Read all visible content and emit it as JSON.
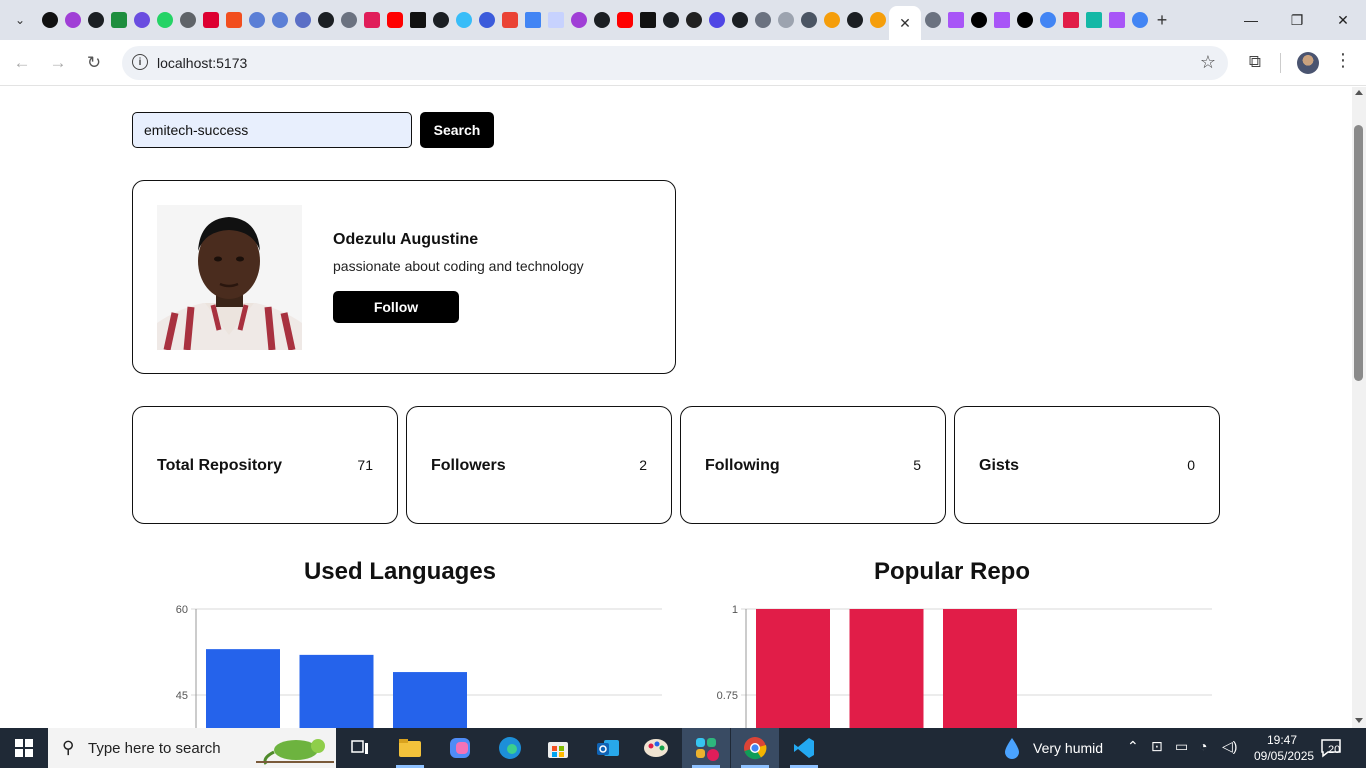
{
  "browser": {
    "url": "localhost:5173",
    "tab_close": "✕"
  },
  "search": {
    "value": "emitech-success",
    "button": "Search"
  },
  "profile": {
    "name": "Odezulu Augustine",
    "bio": "passionate about coding and technology",
    "follow_label": "Follow"
  },
  "stats": [
    {
      "label": "Total Repository",
      "value": "71"
    },
    {
      "label": "Followers",
      "value": "2"
    },
    {
      "label": "Following",
      "value": "5"
    },
    {
      "label": "Gists",
      "value": "0"
    }
  ],
  "charts": {
    "languages_title": "Used Languages",
    "repo_title": "Popular Repo"
  },
  "chart_data": [
    {
      "type": "bar",
      "title": "Used Languages",
      "color": "#2563eb",
      "values": [
        53,
        52,
        49
      ],
      "ylim": [
        0,
        60
      ],
      "yticks": [
        "60",
        "45"
      ],
      "grid": true
    },
    {
      "type": "bar",
      "title": "Popular Repo",
      "color": "#e11d48",
      "values": [
        1,
        1,
        1
      ],
      "ylim": [
        0,
        1
      ],
      "yticks": [
        "1",
        "0.75"
      ],
      "grid": true
    }
  ],
  "taskbar": {
    "search_placeholder": "Type here to search",
    "weather": "Very humid",
    "time": "19:47",
    "date": "09/05/2025",
    "notifications": "20"
  }
}
